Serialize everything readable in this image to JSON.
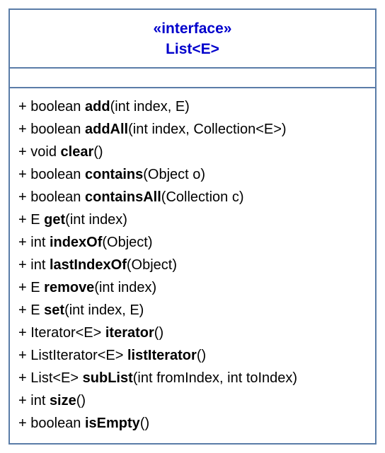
{
  "header": {
    "stereotype": "«interface»",
    "name": "List<E>"
  },
  "methods": [
    {
      "visibility": "+",
      "returnType": "boolean",
      "name": "add",
      "params": "(int index, E)"
    },
    {
      "visibility": "+",
      "returnType": "boolean",
      "name": "addAll",
      "params": "(int index, Collection<E>)"
    },
    {
      "visibility": "+",
      "returnType": "void",
      "name": "clear",
      "params": "()"
    },
    {
      "visibility": "+",
      "returnType": "boolean",
      "name": "contains",
      "params": "(Object o)"
    },
    {
      "visibility": "+",
      "returnType": "boolean",
      "name": "containsAll",
      "params": "(Collection c)"
    },
    {
      "visibility": "+",
      "returnType": "E",
      "name": "get",
      "params": "(int index)"
    },
    {
      "visibility": "+",
      "returnType": "int",
      "name": "indexOf",
      "params": "(Object)"
    },
    {
      "visibility": "+",
      "returnType": "int",
      "name": "lastIndexOf",
      "params": "(Object)"
    },
    {
      "visibility": "+",
      "returnType": "E",
      "name": "remove",
      "params": "(int index)"
    },
    {
      "visibility": "+",
      "returnType": "E",
      "name": "set",
      "params": "(int index, E)"
    },
    {
      "visibility": "+",
      "returnType": "Iterator<E>",
      "name": "iterator",
      "params": "()"
    },
    {
      "visibility": "+",
      "returnType": "ListIterator<E>",
      "name": "listIterator",
      "params": "()"
    },
    {
      "visibility": "+",
      "returnType": "List<E>",
      "name": "subList",
      "params": "(int fromIndex, int toIndex)"
    },
    {
      "visibility": "+",
      "returnType": "int",
      "name": "size",
      "params": "()"
    },
    {
      "visibility": "+",
      "returnType": "boolean",
      "name": "isEmpty",
      "params": "()"
    }
  ]
}
